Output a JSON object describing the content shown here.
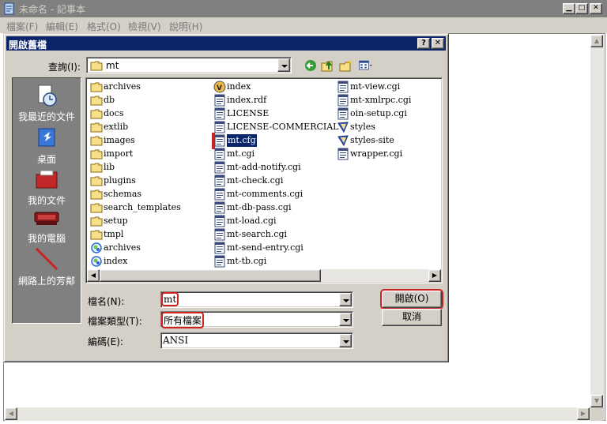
{
  "notepad": {
    "title": "未命名 - 記事本",
    "menus": [
      "檔案(F)",
      "編輯(E)",
      "格式(O)",
      "檢視(V)",
      "說明(H)"
    ]
  },
  "dialog": {
    "title": "開啟舊檔",
    "help_btn": "?",
    "close_btn": "✕",
    "lookin_label": "查詢(I):",
    "lookin_value": "mt",
    "places": [
      "我最近的文件",
      "桌面",
      "我的文件",
      "我的電腦",
      "網路上的芳鄰"
    ],
    "files": {
      "col1": [
        {
          "name": "archives",
          "icon": "folder"
        },
        {
          "name": "db",
          "icon": "folder"
        },
        {
          "name": "docs",
          "icon": "folder"
        },
        {
          "name": "extlib",
          "icon": "folder"
        },
        {
          "name": "images",
          "icon": "folder"
        },
        {
          "name": "import",
          "icon": "folder"
        },
        {
          "name": "lib",
          "icon": "folder"
        },
        {
          "name": "plugins",
          "icon": "folder"
        },
        {
          "name": "schemas",
          "icon": "folder"
        },
        {
          "name": "search_templates",
          "icon": "folder"
        },
        {
          "name": "setup",
          "icon": "folder"
        },
        {
          "name": "tmpl",
          "icon": "folder"
        },
        {
          "name": "archives",
          "icon": "ie-shortcut"
        },
        {
          "name": "index",
          "icon": "ie-shortcut"
        }
      ],
      "col2": [
        {
          "name": "index",
          "icon": "media-file"
        },
        {
          "name": "index.rdf",
          "icon": "script-file"
        },
        {
          "name": "LICENSE",
          "icon": "script-file"
        },
        {
          "name": "LICENSE-COMMERCIAL",
          "icon": "script-file"
        },
        {
          "name": "mt.cfg",
          "icon": "script-file",
          "selected": true
        },
        {
          "name": "mt.cgi",
          "icon": "script-file"
        },
        {
          "name": "mt-add-notify.cgi",
          "icon": "script-file"
        },
        {
          "name": "mt-check.cgi",
          "icon": "script-file"
        },
        {
          "name": "mt-comments.cgi",
          "icon": "script-file"
        },
        {
          "name": "mt-db-pass.cgi",
          "icon": "script-file"
        },
        {
          "name": "mt-load.cgi",
          "icon": "script-file"
        },
        {
          "name": "mt-search.cgi",
          "icon": "script-file"
        },
        {
          "name": "mt-send-entry.cgi",
          "icon": "script-file"
        },
        {
          "name": "mt-tb.cgi",
          "icon": "script-file"
        }
      ],
      "col3": [
        {
          "name": "mt-view.cgi",
          "icon": "script-file"
        },
        {
          "name": "mt-xmlrpc.cgi",
          "icon": "script-file"
        },
        {
          "name": "oin-setup.cgi",
          "icon": "script-file"
        },
        {
          "name": "styles",
          "icon": "css-file"
        },
        {
          "name": "styles-site",
          "icon": "css-file"
        },
        {
          "name": "wrapper.cgi",
          "icon": "script-file"
        }
      ]
    },
    "filename_label": "檔名(N):",
    "filename_value": "mt",
    "filetype_label": "檔案類型(T):",
    "filetype_value": "所有檔案",
    "encoding_label": "編碼(E):",
    "encoding_value": "ANSI",
    "open_btn": "開啟(O)",
    "cancel_btn": "取消"
  }
}
